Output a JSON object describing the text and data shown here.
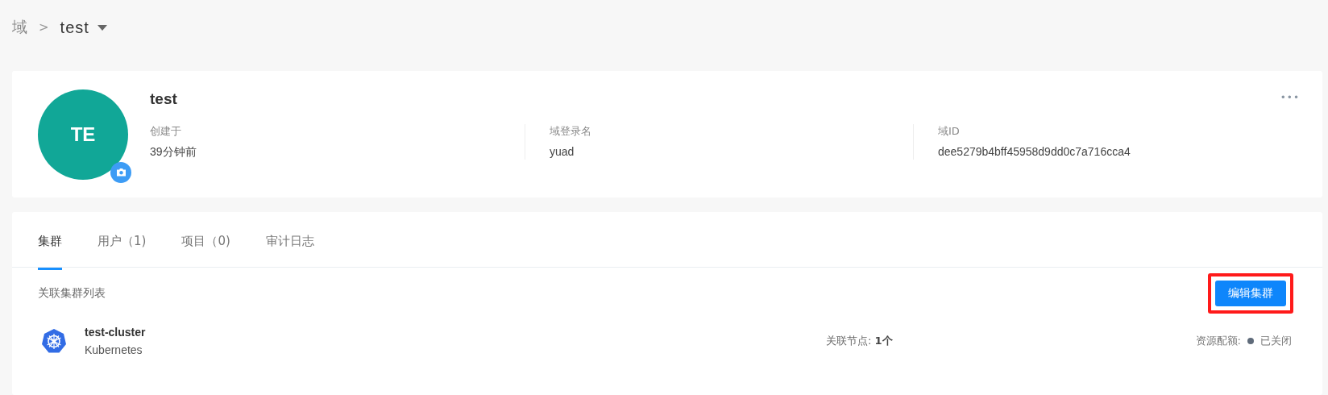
{
  "breadcrumb": {
    "root": "域",
    "separator": ">",
    "current": "test"
  },
  "profile": {
    "avatar_initials": "TE",
    "name": "test",
    "more": "•••",
    "fields": [
      {
        "label": "创建于",
        "value": "39分钟前"
      },
      {
        "label": "域登录名",
        "value": "yuad"
      },
      {
        "label": "域ID",
        "value": "dee5279b4bff45958d9dd0c7a716cca4"
      }
    ]
  },
  "tabs": [
    {
      "label": "集群",
      "selected": true
    },
    {
      "label": "用户（1)",
      "selected": false
    },
    {
      "label": "项目（0)",
      "selected": false
    },
    {
      "label": "审计日志",
      "selected": false
    }
  ],
  "cluster_list": {
    "title": "关联集群列表",
    "edit_button": {
      "label": "编辑集群",
      "highlighted": true
    },
    "clusters": [
      {
        "name": "test-cluster",
        "type": "Kubernetes",
        "nodes_label": "关联节点: ",
        "nodes_value": "1个",
        "quota_label": "资源配额:",
        "quota_status": "已关闭"
      }
    ]
  }
}
